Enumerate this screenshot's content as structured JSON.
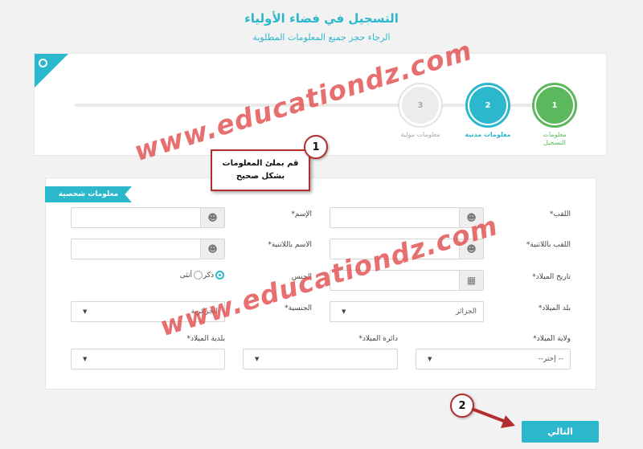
{
  "header": {
    "title": "التسجيل في فضاء الأولياء",
    "subtitle": "الرجاء حجز جميع المعلومات المطلوبة"
  },
  "steps": [
    {
      "number": "1",
      "label_line1": "معلومات",
      "label_line2": "التسجيل",
      "state": "active",
      "color": "#5cb85c"
    },
    {
      "number": "2",
      "label_line1": "معلومات مدنية",
      "label_line2": "",
      "state": "current",
      "color": "#2bb7cc"
    },
    {
      "number": "3",
      "label_line1": "معلومات مولية",
      "label_line2": "",
      "state": "pending",
      "color": "#e9e9e9"
    }
  ],
  "section": {
    "title": "معلومات شخصية"
  },
  "form": {
    "laqab_label": "اللقب*",
    "ism_label": "الإسم*",
    "laqab_latin_label": "اللقب باللاتنية*",
    "ism_latin_label": "الاسم باللاتنية*",
    "birthdate_label": "تاريخ الميلاد*",
    "gender_label": "الجنس",
    "gender_male": "ذكر",
    "gender_female": "أنثى",
    "birth_country_label": "بلد الميلاد*",
    "birth_country_value": "الجزائر",
    "nationality_label": "الجنسية*",
    "nationality_value": "الجزائرية",
    "birth_wilaya_label": "ولاية الميلاد*",
    "birth_wilaya_value": "--إختر --",
    "birth_daira_label": "دائرة الميلاد*",
    "birth_baladiya_label": "بلدية الميلاد*"
  },
  "annotations": {
    "callout_line1": "قم بملئ المعلومات",
    "callout_line2": "بشكل صحيح",
    "badge1": "1",
    "badge2": "2"
  },
  "watermark": "www.educationdz.com",
  "buttons": {
    "next": "التالي"
  },
  "colors": {
    "accent": "#2bb7cc",
    "success": "#5cb85c",
    "annotation": "#b22e2e"
  }
}
